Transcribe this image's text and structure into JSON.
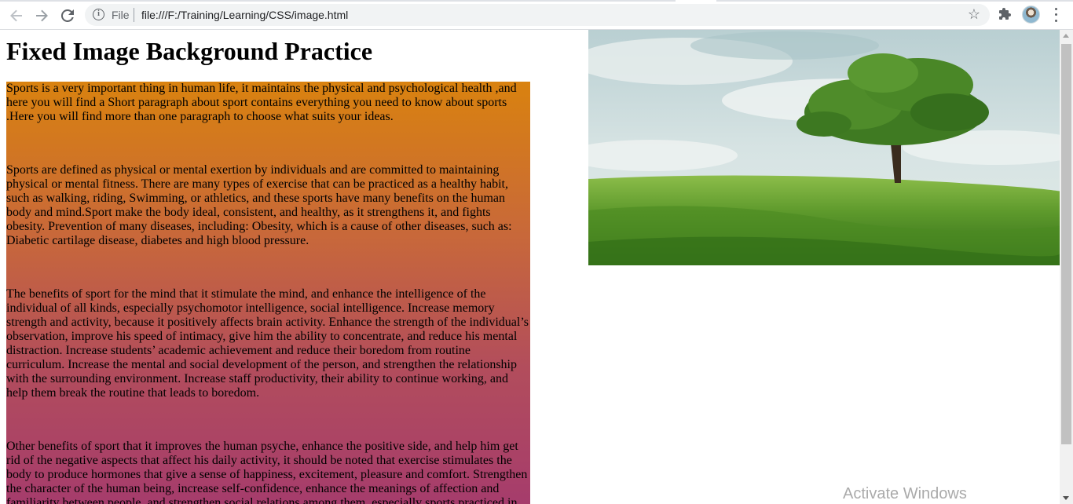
{
  "browser": {
    "back_icon": "arrow-left-icon",
    "forward_icon": "arrow-right-icon",
    "reload_icon": "reload-icon",
    "info_icon": "info-icon",
    "file_label": "File",
    "url": "file:///F:/Training/Learning/CSS/image.html",
    "bookmark_icon": "star-icon",
    "extensions_icon": "puzzle-icon",
    "profile_icon": "avatar",
    "menu_icon": "kebab-menu-icon"
  },
  "page": {
    "title": "Fixed Image Background Practice",
    "paragraphs": [
      "Sports is a very important thing in human life, it maintains the physical and psychological health ,and here you will find a Short paragraph about sport contains everything you need to know about sports .Here you will find more than one paragraph to choose what suits your ideas.",
      "Sports are defined as physical or mental exertion by individuals and are committed to maintaining physical or mental fitness. There are many types of exercise that can be practiced as a healthy habit, such as walking, riding, Swimming, or athletics, and these sports have many benefits on the human body and mind.Sport make the body ideal, consistent, and healthy, as it strengthens it, and fights obesity. Prevention of many diseases, including: Obesity, which is a cause of other diseases, such as: Diabetic cartilage disease, diabetes and high blood pressure.",
      "The benefits of sport for the mind that it stimulate the mind, and enhance the intelligence of the individual of all kinds, especially psychomotor intelligence, social intelligence. Increase memory strength and activity, because it positively affects brain activity. Enhance the strength of the individual’s observation, improve his speed of intimacy, give him the ability to concentrate, and reduce his mental distraction. Increase students’ academic achievement and reduce their boredom from routine curriculum. Increase the mental and social development of the person, and strengthen the relationship with the surrounding environment. Increase staff productivity, their ability to continue working, and help them break the routine that leads to boredom.",
      "Other benefits of sport that it improves the human psyche, enhance the positive side, and help him get rid of the negative aspects that affect his daily activity, it should be noted that exercise stimulates the body to produce hormones that give a sense of happiness, excitement, pleasure and comfort. Strengthen the character of the human being, increase self-confidence, enhance the meanings of affection and familiarity between people, and strengthen social relations among them, especially sports practiced in groups."
    ],
    "hero_image": "tree-in-green-field-image",
    "colors": {
      "gradient_top": "#d9820f",
      "gradient_bottom": "#a43a6e"
    }
  },
  "os": {
    "watermark": "Activate Windows"
  }
}
